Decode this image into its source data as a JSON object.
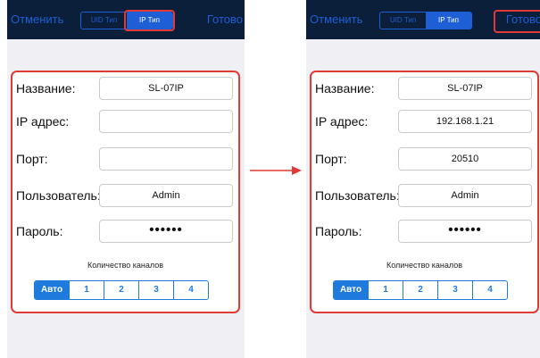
{
  "screens": [
    {
      "nav": {
        "cancel": "Отменить",
        "done": "Готово",
        "tabs": [
          "UID Тип",
          "IP Тип"
        ],
        "active_tab": 1
      },
      "fields": [
        {
          "label": "Название:",
          "value": "SL-07IP"
        },
        {
          "label": "IP адрес:",
          "value": ""
        },
        {
          "label": "Порт:",
          "value": ""
        },
        {
          "label": "Пользователь:",
          "value": "Admin"
        },
        {
          "label": "Пароль:",
          "value": "••••••"
        }
      ],
      "channels": {
        "label": "Количество каналов",
        "options": [
          "Авто",
          "1",
          "2",
          "3",
          "4"
        ],
        "selected": 0
      }
    },
    {
      "nav": {
        "cancel": "Отменить",
        "done": "Готово",
        "tabs": [
          "UID Тип",
          "IP Тип"
        ],
        "active_tab": 1
      },
      "fields": [
        {
          "label": "Название:",
          "value": "SL-07IP"
        },
        {
          "label": "IP адрес:",
          "value": "192.168.1.21"
        },
        {
          "label": "Порт:",
          "value": "20510"
        },
        {
          "label": "Пользователь:",
          "value": "Admin"
        },
        {
          "label": "Пароль:",
          "value": "••••••"
        }
      ],
      "channels": {
        "label": "Количество каналов",
        "options": [
          "Авто",
          "1",
          "2",
          "3",
          "4"
        ],
        "selected": 0
      }
    }
  ],
  "colors": {
    "navbar": "#0b1e3a",
    "accent": "#1e5fd6",
    "segment_accent": "#1e7bdd",
    "highlight": "#e03a34",
    "background": "#efeff4"
  },
  "icons": {
    "arrow": "right-arrow-icon"
  }
}
